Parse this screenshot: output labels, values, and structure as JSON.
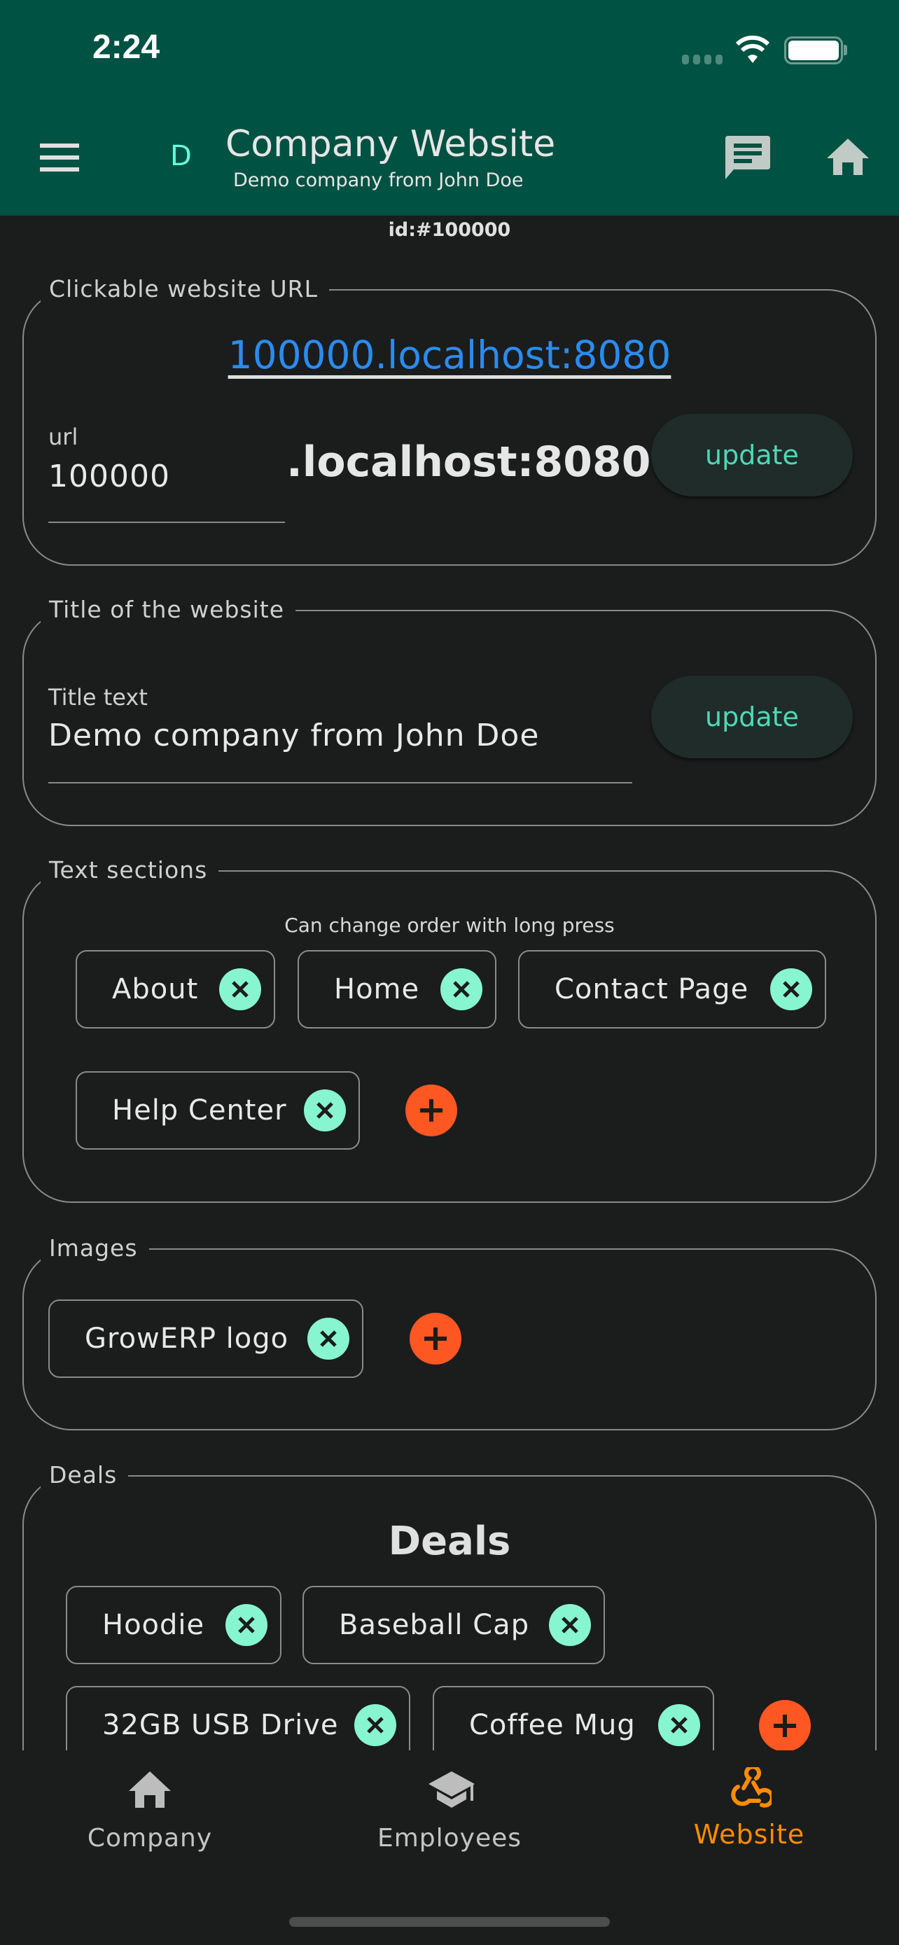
{
  "status_bar": {
    "time": "2:24"
  },
  "header": {
    "avatar_letter": "D",
    "title": "Company Website",
    "subtitle": "Demo company from John Doe",
    "icons": [
      "menu-icon",
      "chat-icon",
      "home-icon"
    ]
  },
  "id_label": "id:#100000",
  "url_section": {
    "label": "Clickable website URL",
    "link": "100000.localhost:8080",
    "field_label": "url",
    "field_value": "100000",
    "suffix": ".localhost:8080",
    "button": "update"
  },
  "title_section": {
    "label": "Title of the website",
    "field_label": "Title text",
    "field_value": "Demo company from John Doe",
    "button": "update"
  },
  "text_sections": {
    "label": "Text sections",
    "hint": "Can change order with long press",
    "chips": [
      "About",
      "Home",
      "Contact Page",
      "Help Center"
    ]
  },
  "images": {
    "label": "Images",
    "chips": [
      "GrowERP logo"
    ]
  },
  "deals": {
    "label": "Deals",
    "heading": "Deals",
    "chips": [
      "Hoodie",
      "Baseball Cap",
      "32GB USB Drive",
      "Coffee Mug"
    ]
  },
  "bottom_nav": {
    "items": [
      {
        "label": "Company",
        "icon": "home-icon"
      },
      {
        "label": "Employees",
        "icon": "school-icon"
      },
      {
        "label": "Website",
        "icon": "webhook-icon",
        "active": true
      }
    ]
  },
  "colors": {
    "header": "#005243",
    "background": "#1b1c1c",
    "accent": "#64ffda",
    "active_nav": "#ff8c00",
    "add": "#ff5722",
    "link": "#2a8cf0"
  }
}
